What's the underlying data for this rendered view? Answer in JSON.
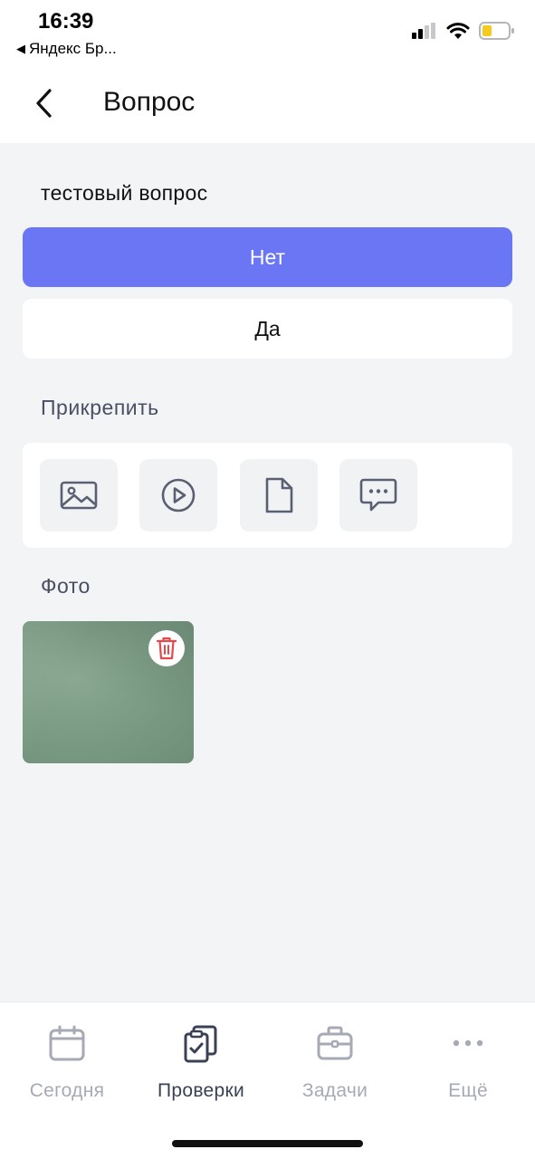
{
  "status_bar": {
    "time": "16:39",
    "back_app": "Яндекс Бр...",
    "back_arrow": "◀"
  },
  "header": {
    "title": "Вопрос",
    "back_icon": "chevron-left-icon"
  },
  "question": {
    "text": "тестовый вопрос",
    "options": [
      {
        "label": "Нет",
        "selected": true
      },
      {
        "label": "Да",
        "selected": false
      }
    ]
  },
  "attach": {
    "label": "Прикрепить",
    "buttons": [
      {
        "icon": "image-icon"
      },
      {
        "icon": "video-icon"
      },
      {
        "icon": "file-icon"
      },
      {
        "icon": "comment-icon"
      }
    ]
  },
  "photos": {
    "label": "Фото",
    "delete_icon": "trash-icon"
  },
  "tabbar": {
    "tabs": [
      {
        "label": "Сегодня",
        "icon": "calendar-icon",
        "active": false
      },
      {
        "label": "Проверки",
        "icon": "clipboard-check-icon",
        "active": true
      },
      {
        "label": "Задачи",
        "icon": "briefcase-icon",
        "active": false
      },
      {
        "label": "Ещё",
        "icon": "more-icon",
        "active": false
      }
    ]
  },
  "colors": {
    "accent": "#6a76f4",
    "background": "#f3f4f6",
    "delete": "#e5484d",
    "icon_gray": "#5a6072"
  }
}
